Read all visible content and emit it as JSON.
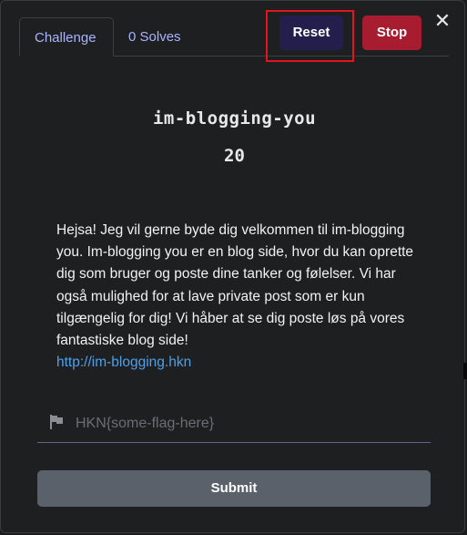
{
  "tabs": [
    {
      "label": "Challenge"
    },
    {
      "label": "0 Solves"
    }
  ],
  "header": {
    "reset_label": "Reset",
    "stop_label": "Stop",
    "close_symbol": "✕"
  },
  "challenge": {
    "name": "im-blogging-you",
    "points": "20",
    "description": "Hejsa! Jeg vil gerne byde dig velkommen til im-blogging you. Im-blogging you er en blog side, hvor du kan oprette dig som bruger og poste dine tanker og følelser. Vi har også mulighed for at lave private post som er kun tilgængelig for dig! Vi håber at se dig poste løs på vores fantastiske blog side!",
    "link": "http://im-blogging.hkn"
  },
  "flag": {
    "placeholder": "HKN{some-flag-here}",
    "value": "",
    "icon": "flag-icon"
  },
  "submit_label": "Submit",
  "colors": {
    "reset_bg": "#231e4b",
    "stop_bg": "#a71d2f",
    "highlight": "#e3151c",
    "link": "#4ea0ea",
    "tab_text": "#a9b3ff"
  }
}
